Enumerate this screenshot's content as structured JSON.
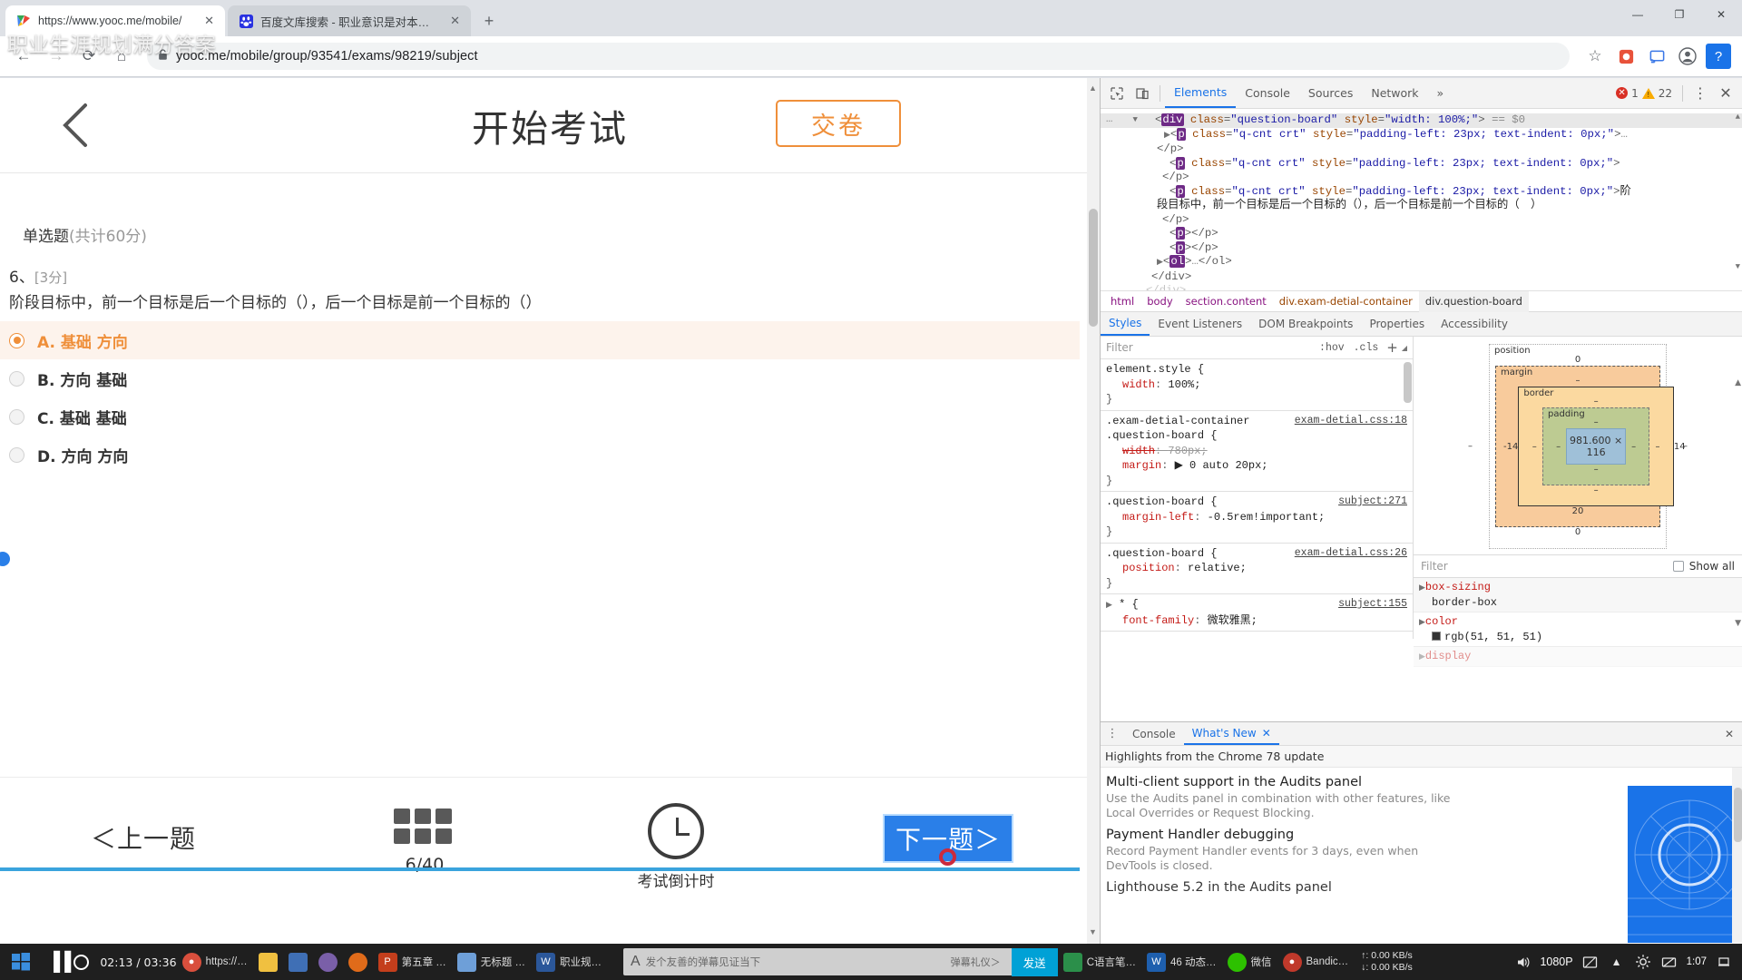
{
  "browser": {
    "tabs": [
      {
        "title": "https://www.yooc.me/mobile/",
        "favicon": "colorful-logo-icon",
        "active": true,
        "close_label": "✕"
      },
      {
        "title": "百度文库搜索 - 职业意识是对本…",
        "favicon": "baidu-paw-icon",
        "active": false,
        "close_label": "✕"
      }
    ],
    "new_tab_label": "+",
    "window_controls": {
      "minimize": "—",
      "maximize": "❐",
      "close": "✕"
    },
    "nav": {
      "back": "←",
      "forward": "→",
      "reload": "⟳",
      "home": "⌂"
    },
    "address": {
      "lock_icon": "lock-icon",
      "url": "yooc.me/mobile/group/93541/exams/98219/subject"
    },
    "toolbar_right": {
      "bookmark": "☆",
      "ext1": "puzzle-icon",
      "ext2": "cast-icon",
      "profile": "avatar-icon",
      "menu": "⋮",
      "help_badge": "?"
    },
    "watermark": "职业生涯规划满分答案"
  },
  "exam": {
    "back_icon": "back-chevron-icon",
    "title": "开始考试",
    "submit_label": "交卷",
    "section_label": "单选题",
    "section_score": "(共计60分)",
    "question_number": "6、",
    "question_points": "[3分]",
    "question_text": "阶段目标中，前一个目标是后一个目标的（），后一个目标是前一个目标的（）",
    "options": [
      {
        "label": "A. 基础 方向",
        "selected": true
      },
      {
        "label": "B. 方向 基础",
        "selected": false
      },
      {
        "label": "C. 基础 基础",
        "selected": false
      },
      {
        "label": "D. 方向 方向",
        "selected": false
      }
    ],
    "footer": {
      "prev_label": "＜上一题",
      "grid_icon": "question-grid-icon",
      "progress": "6/40",
      "clock_icon": "clock-icon",
      "countdown_label": "考试倒计时",
      "next_label": "下一题＞"
    },
    "selected_accent": "#ef8f3a",
    "next_button_color": "#2a7fe8"
  },
  "devtools": {
    "inspect_icon": "inspect-cursor-icon",
    "device_icon": "device-toolbar-icon",
    "tabs": [
      {
        "label": "Elements",
        "active": true
      },
      {
        "label": "Console",
        "active": false
      },
      {
        "label": "Sources",
        "active": false
      },
      {
        "label": "Network",
        "active": false
      }
    ],
    "more_tabs": "»",
    "errors": "1",
    "warnings": "22",
    "kebab": "⋮",
    "close": "✕",
    "dom": [
      {
        "indent": 0,
        "prefix": "…",
        "html": "",
        "selected": false,
        "raw": "…"
      },
      {
        "indent": 1,
        "selected": true,
        "raw": "▼<div class=\"question-board\" style=\"width: 100%;\"> == $0"
      },
      {
        "indent": 2,
        "selected": false,
        "raw": "▶<p class=\"q-cnt crt\" style=\"padding-left: 23px; text-indent: 0px;\">…"
      },
      {
        "indent": 2,
        "selected": false,
        "raw": "</p>"
      },
      {
        "indent": 2,
        "selected": false,
        "raw": "<p class=\"q-cnt crt\" style=\"padding-left: 23px; text-indent: 0px;\">"
      },
      {
        "indent": 2,
        "selected": false,
        "raw": "</p>"
      },
      {
        "indent": 2,
        "selected": false,
        "raw": "<p class=\"q-cnt crt\" style=\"padding-left: 23px; text-indent: 0px;\">阶"
      },
      {
        "indent": 2,
        "selected": false,
        "raw": "段目标中，前一个目标是后一个目标的（），后一个目标是前一个目标的（　）"
      },
      {
        "indent": 2,
        "selected": false,
        "raw": "</p>"
      },
      {
        "indent": 2,
        "selected": false,
        "raw": "<p></p>"
      },
      {
        "indent": 2,
        "selected": false,
        "raw": "<p></p>"
      },
      {
        "indent": 2,
        "selected": false,
        "raw": "▶<ol>…</ol>"
      },
      {
        "indent": 1,
        "selected": false,
        "raw": "</div>"
      }
    ],
    "breadcrumbs": [
      {
        "label": "html",
        "active": false
      },
      {
        "label": "body",
        "active": false
      },
      {
        "label": "section.content",
        "active": false
      },
      {
        "label": "div.exam-detial-container",
        "active": false
      },
      {
        "label": "div.question-board",
        "active": true
      }
    ],
    "subtabs": [
      {
        "label": "Styles",
        "active": true
      },
      {
        "label": "Event Listeners",
        "active": false
      },
      {
        "label": "DOM Breakpoints",
        "active": false
      },
      {
        "label": "Properties",
        "active": false
      },
      {
        "label": "Accessibility",
        "active": false
      }
    ],
    "filter_placeholder": "Filter",
    "hov_label": ":hov",
    "cls_label": ".cls",
    "plus_label": "+",
    "rules": [
      {
        "selector": "element.style {",
        "source": "",
        "decls": [
          {
            "prop": "width",
            "value": "100%;",
            "struck": false
          }
        ],
        "close": "}"
      },
      {
        "selector": ".exam-detial-container\n.question-board {",
        "selector_lines": [
          ".exam-detial-container",
          ".question-board {"
        ],
        "source": "exam-detial.css:18",
        "decls": [
          {
            "prop": "width",
            "value": "780px;",
            "struck": true
          },
          {
            "prop": "margin",
            "value": "▶ 0 auto 20px;",
            "struck": false
          }
        ],
        "close": "}"
      },
      {
        "selector_lines": [
          ".question-board {"
        ],
        "source": "subject:271",
        "decls": [
          {
            "prop": "margin-left",
            "value": "-0.5rem!important;",
            "struck": false
          }
        ],
        "close": "}"
      },
      {
        "selector_lines": [
          ".question-board {"
        ],
        "source": "exam-detial.css:26",
        "decls": [
          {
            "prop": "position",
            "value": "relative;",
            "struck": false
          }
        ],
        "close": "}"
      },
      {
        "selector_lines": [
          "* {"
        ],
        "source": "subject:155",
        "decls": [
          {
            "prop": "font-family",
            "value": "微软雅黑;",
            "struck": false
          }
        ],
        "close": ""
      }
    ],
    "boxmodel": {
      "position_label": "position",
      "position_top": "0",
      "position_bottom": "0",
      "position_left": "–",
      "position_right": "–",
      "margin_label": "margin",
      "margin_top": "–",
      "margin_bottom": "20",
      "margin_left": "-14",
      "margin_right": "14",
      "border_label": "border",
      "border_top": "–",
      "border_bottom": "–",
      "border_left": "–",
      "border_right": "–",
      "padding_label": "padding",
      "padding_top": "–",
      "padding_bottom": "–",
      "padding_left": "–",
      "padding_right": "–",
      "content_size": "981.600 × 116"
    },
    "computed_filter_placeholder": "Filter",
    "show_all_label": "Show all",
    "computed_props": [
      {
        "name": "box-sizing",
        "value": "border-box",
        "swatch": null
      },
      {
        "name": "color",
        "value": "rgb(51, 51, 51)",
        "swatch": "#333333"
      },
      {
        "name": "display",
        "value": "",
        "swatch": null
      }
    ],
    "drawer": {
      "kebab": "⋮",
      "tabs": [
        {
          "label": "Console",
          "active": false,
          "closable": false
        },
        {
          "label": "What's New",
          "active": true,
          "closable": true
        }
      ],
      "close": "✕",
      "header": "Highlights from the Chrome 78 update",
      "items": [
        {
          "title": "Multi-client support in the Audits panel",
          "desc": "Use the Audits panel in combination with other features, like Local Overrides or Request Blocking."
        },
        {
          "title": "Payment Handler debugging",
          "desc": "Record Payment Handler events for 3 days, even when DevTools is closed."
        },
        {
          "title": "Lighthouse 5.2 in the Audits panel",
          "desc": ""
        }
      ]
    }
  },
  "taskbar": {
    "start_icon": "windows-start-icon",
    "media": {
      "pause_icon": "pause-icon",
      "record_icon": "record-icon",
      "time": "02:13 / 03:36"
    },
    "items": [
      {
        "label": "https://…",
        "icon": "chrome-icon",
        "color": "#d94f3d"
      },
      {
        "label": "",
        "icon": "explorer-icon",
        "color": "#f0c040"
      },
      {
        "label": "",
        "icon": "app-icon",
        "color": "#3f6fb5"
      },
      {
        "label": "",
        "icon": "app-icon",
        "color": "#7a5fa8"
      },
      {
        "label": "",
        "icon": "firefox-icon",
        "color": "#e06b1a"
      },
      {
        "label": "第五章 …",
        "icon": "ppt-icon",
        "color": "#c43e1c"
      },
      {
        "label": "无标题 …",
        "icon": "notepad-icon",
        "color": "#6e9fd8"
      },
      {
        "label": "职业规…",
        "icon": "word-icon",
        "color": "#2b579a"
      }
    ],
    "danmu": {
      "font_icon": "font-a-icon",
      "placeholder": "发个友善的弹幕见证当下",
      "send_label": "发送",
      "mode_label": "弹幕礼仪＞"
    },
    "right_items": [
      {
        "label": "C语言笔…",
        "icon": "doc-icon"
      },
      {
        "label": "46 动态…",
        "icon": "w-icon"
      },
      {
        "label": "微信",
        "icon": "wechat-icon"
      },
      {
        "label": "Bandic…",
        "icon": "bandicam-icon"
      }
    ],
    "netspeed": {
      "up": "↑: 0.00 KB/s",
      "down": "↓: 0.00 KB/s"
    },
    "tray": {
      "volume_icon": "volume-icon",
      "resolution": "1080P",
      "fullscreen_icon": "fullscreen-icon",
      "settings_icon": "gear-icon",
      "network_icon": "network-icon",
      "time": "1:07"
    }
  }
}
